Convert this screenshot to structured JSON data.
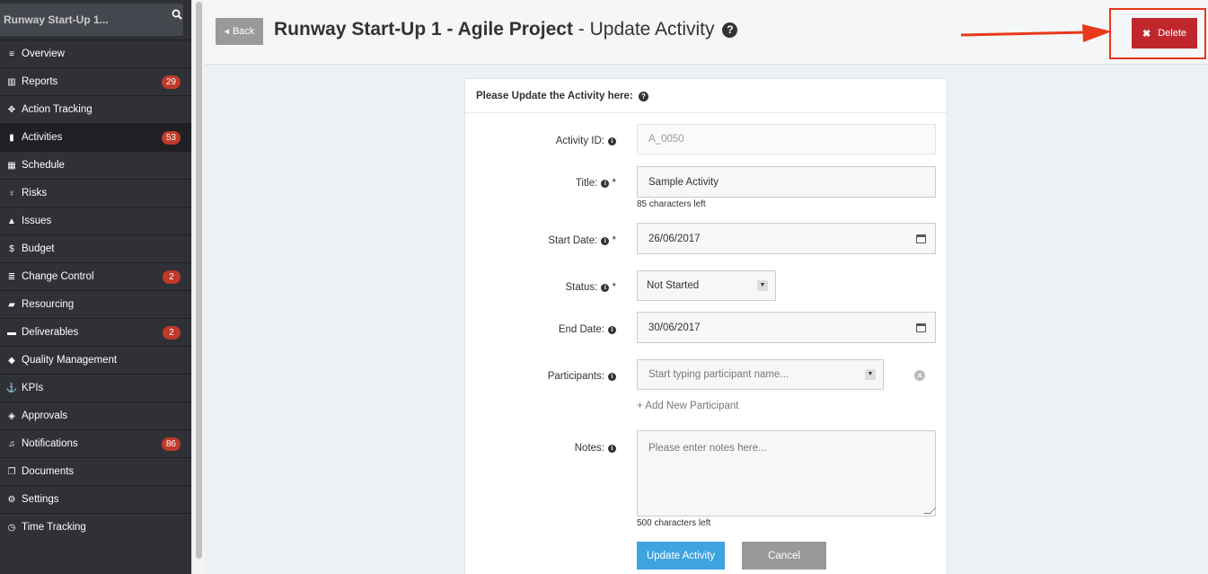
{
  "sidebar": {
    "project": "Runway Start-Up 1...",
    "items": [
      {
        "label": "Overview",
        "icon": "list-icon",
        "glyph": "≡"
      },
      {
        "label": "Reports",
        "icon": "bar-chart-icon",
        "glyph": "▥",
        "badge": "29"
      },
      {
        "label": "Action Tracking",
        "icon": "crosshair-icon",
        "glyph": "✥"
      },
      {
        "label": "Activities",
        "icon": "bookmark-icon",
        "glyph": "▮",
        "badge": "53",
        "active": true
      },
      {
        "label": "Schedule",
        "icon": "calendar-icon",
        "glyph": "▦"
      },
      {
        "label": "Risks",
        "icon": "lightbulb-icon",
        "glyph": "♀"
      },
      {
        "label": "Issues",
        "icon": "warning-icon",
        "glyph": "▲"
      },
      {
        "label": "Budget",
        "icon": "dollar-icon",
        "glyph": "$"
      },
      {
        "label": "Change Control",
        "icon": "list-icon",
        "glyph": "≣",
        "badge": "2"
      },
      {
        "label": "Resourcing",
        "icon": "folder-open-icon",
        "glyph": "▰"
      },
      {
        "label": "Deliverables",
        "icon": "truck-icon",
        "glyph": "▬",
        "badge": "2"
      },
      {
        "label": "Quality Management",
        "icon": "tag-icon",
        "glyph": "◆"
      },
      {
        "label": "KPIs",
        "icon": "anchor-icon",
        "glyph": "⚓"
      },
      {
        "label": "Approvals",
        "icon": "ticket-icon",
        "glyph": "◈"
      },
      {
        "label": "Notifications",
        "icon": "bell-icon",
        "glyph": "♫",
        "badge": "86"
      },
      {
        "label": "Documents",
        "icon": "copy-icon",
        "glyph": "❐"
      },
      {
        "label": "Settings",
        "icon": "gears-icon",
        "glyph": "⚙"
      },
      {
        "label": "Time Tracking",
        "icon": "clock-icon",
        "glyph": "◷"
      }
    ]
  },
  "header": {
    "back_label": "Back",
    "project_title": "Runway Start-Up 1 - Agile Project",
    "subtitle": " - Update Activity",
    "delete_label": "Delete"
  },
  "form": {
    "heading": "Please Update the Activity here:",
    "activity_id_label": "Activity ID:",
    "activity_id_value": "A_0050",
    "title_label": "Title:",
    "title_value": "Sample Activity",
    "title_hint": "85 characters left",
    "start_date_label": "Start Date:",
    "start_date_value": "26/06/2017",
    "status_label": "Status:",
    "status_value": "Not Started",
    "end_date_label": "End Date:",
    "end_date_value": "30/06/2017",
    "participants_label": "Participants:",
    "participants_placeholder": "Start typing participant name...",
    "add_participant": "+ Add New Participant",
    "notes_label": "Notes:",
    "notes_placeholder": "Please enter notes here...",
    "notes_hint": "500 characters left",
    "update_label": "Update Activity",
    "cancel_label": "Cancel"
  },
  "colors": {
    "accent": "#3fa3e0",
    "delete": "#c0272d",
    "highlight": "#e8391c",
    "badge": "#c0392b"
  }
}
